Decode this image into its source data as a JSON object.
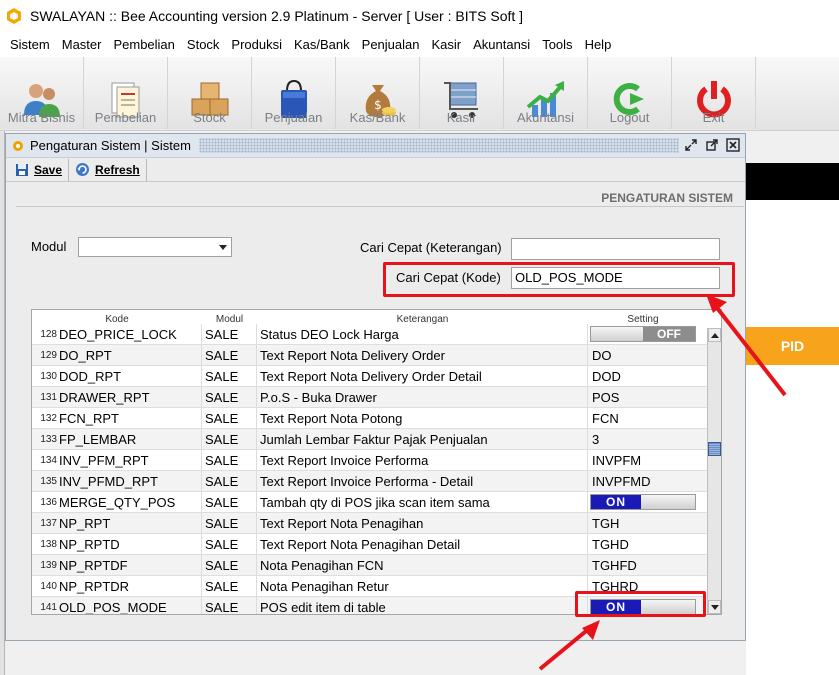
{
  "window_title": "SWALAYAN :: Bee Accounting version 2.9 Platinum - Server  [ User : BITS Soft ]",
  "menu": [
    "Sistem",
    "Master",
    "Pembelian",
    "Stock",
    "Produksi",
    "Kas/Bank",
    "Penjualan",
    "Kasir",
    "Akuntansi",
    "Tools",
    "Help"
  ],
  "toolbar": {
    "mitra": "Mitra Bisnis",
    "pembelian": "Pembelian",
    "stock": "Stock",
    "penjualan": "Penjualan",
    "kasbank": "Kas/Bank",
    "kasir": "Kasir",
    "akuntansi": "Akuntansi",
    "logout": "Logout",
    "exit": "Exit"
  },
  "background": {
    "pid_label": "PID"
  },
  "subwindow": {
    "title": "Pengaturan Sistem | Sistem",
    "save": "Save",
    "refresh": "Refresh",
    "header": "PENGATURAN SISTEM"
  },
  "filters": {
    "modul_label": "Modul",
    "modul_value": "",
    "cari_ket_label": "Cari Cepat (Keterangan)",
    "cari_ket_value": "",
    "cari_kode_label": "Cari Cepat (Kode)",
    "cari_kode_value": "OLD_POS_MODE"
  },
  "table": {
    "headers": {
      "kode": "Kode",
      "modul": "Modul",
      "keterangan": "Keterangan",
      "setting": "Setting"
    },
    "rows": [
      {
        "no": "128",
        "kode": "DEO_PRICE_LOCK",
        "modul": "SALE",
        "ket": "Status DEO Lock Harga",
        "setting": "OFF",
        "toggle": "off"
      },
      {
        "no": "129",
        "kode": "DO_RPT",
        "modul": "SALE",
        "ket": "Text Report Nota Delivery Order",
        "setting": "DO"
      },
      {
        "no": "130",
        "kode": "DOD_RPT",
        "modul": "SALE",
        "ket": "Text Report Nota Delivery Order Detail",
        "setting": "DOD"
      },
      {
        "no": "131",
        "kode": "DRAWER_RPT",
        "modul": "SALE",
        "ket": "P.o.S - Buka Drawer",
        "setting": "POS"
      },
      {
        "no": "132",
        "kode": "FCN_RPT",
        "modul": "SALE",
        "ket": "Text Report Nota Potong",
        "setting": "FCN"
      },
      {
        "no": "133",
        "kode": "FP_LEMBAR",
        "modul": "SALE",
        "ket": "Jumlah Lembar Faktur Pajak Penjualan",
        "setting": "3"
      },
      {
        "no": "134",
        "kode": "INV_PFM_RPT",
        "modul": "SALE",
        "ket": "Text Report Invoice Performa",
        "setting": "INVPFM"
      },
      {
        "no": "135",
        "kode": "INV_PFMD_RPT",
        "modul": "SALE",
        "ket": "Text Report Invoice Performa - Detail",
        "setting": "INVPFMD"
      },
      {
        "no": "136",
        "kode": "MERGE_QTY_POS",
        "modul": "SALE",
        "ket": "Tambah qty di POS jika scan item sama",
        "setting": "ON",
        "toggle": "on"
      },
      {
        "no": "137",
        "kode": "NP_RPT",
        "modul": "SALE",
        "ket": "Text Report Nota Penagihan",
        "setting": "TGH"
      },
      {
        "no": "138",
        "kode": "NP_RPTD",
        "modul": "SALE",
        "ket": "Text Report Nota Penagihan Detail",
        "setting": "TGHD"
      },
      {
        "no": "139",
        "kode": "NP_RPTDF",
        "modul": "SALE",
        "ket": "Nota Penagihan FCN",
        "setting": "TGHFD"
      },
      {
        "no": "140",
        "kode": "NP_RPTDR",
        "modul": "SALE",
        "ket": "Nota Penagihan Retur",
        "setting": "TGHRD"
      },
      {
        "no": "141",
        "kode": "OLD_POS_MODE",
        "modul": "SALE",
        "ket": "POS edit item di table",
        "setting": "ON",
        "toggle": "on"
      }
    ]
  },
  "colors": {
    "highlight": "#e8121a",
    "toggle_on": "#1a1ab7",
    "pid_bg": "#f7a31c"
  }
}
